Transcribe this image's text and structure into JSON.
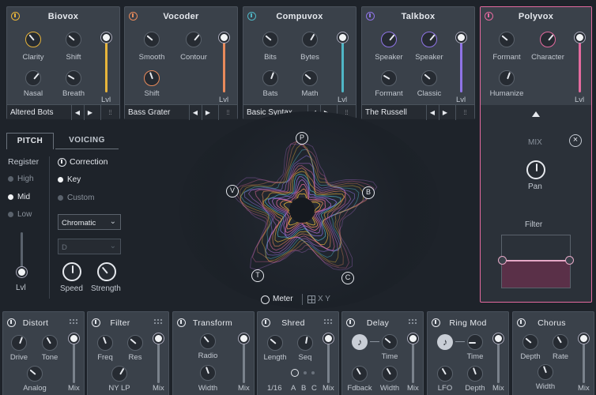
{
  "modules": [
    {
      "name": "Biovox",
      "color": "#e7b43b",
      "knobs": [
        "Clarity",
        "Shift",
        "Nasal",
        "Breath"
      ],
      "fader_label": "Lvl",
      "preset": "Altered Bots"
    },
    {
      "name": "Vocoder",
      "color": "#e88a5b",
      "knobs": [
        "Smooth",
        "Contour",
        "Shift"
      ],
      "fader_label": "Lvl",
      "preset": "Bass Grater"
    },
    {
      "name": "Compuvox",
      "color": "#4fb6c6",
      "knobs": [
        "Bits",
        "Bytes",
        "Bats",
        "Math"
      ],
      "fader_label": "Lvl",
      "preset": "Basic Syntax"
    },
    {
      "name": "Talkbox",
      "color": "#8f74e6",
      "knobs": [
        "Speaker",
        "Speaker",
        "Formant",
        "Classic"
      ],
      "fader_label": "Lvl",
      "preset": "The Russell"
    },
    {
      "name": "Polyvox",
      "color": "#e46a9f",
      "knobs": [
        "Formant",
        "Character",
        "Humanize"
      ],
      "fader_label": "Lvl"
    }
  ],
  "pitch": {
    "tabs": [
      "PITCH",
      "VOICING"
    ],
    "register_label": "Register",
    "registers": [
      "High",
      "Mid",
      "Low"
    ],
    "correction_label": "Correction",
    "corrections": [
      "Key",
      "Custom"
    ],
    "scale": "Chromatic",
    "key": "D",
    "lvl_label": "Lvl",
    "speed_label": "Speed",
    "strength_label": "Strength"
  },
  "visual": {
    "nodes": [
      "P",
      "B",
      "C",
      "T",
      "V"
    ],
    "meter_label": "Meter",
    "xy_label": "X Y"
  },
  "polyvox_panel": {
    "mix_label": "MIX",
    "pan_label": "Pan",
    "filter_label": "Filter"
  },
  "fx": [
    {
      "name": "Distort",
      "knobs": [
        "Drive",
        "Tone",
        "Analog"
      ],
      "fader_label": "Mix"
    },
    {
      "name": "Filter",
      "knobs": [
        "Freq",
        "Res",
        "NY LP"
      ],
      "fader_label": "Mix"
    },
    {
      "name": "Transform",
      "knobs": [
        "Radio",
        "Width"
      ],
      "fader_label": "Mix"
    },
    {
      "name": "Shred",
      "knobs": [
        "Length",
        "Seq"
      ],
      "extra": [
        "1/16",
        "A",
        "B",
        "C"
      ],
      "fader_label": "Mix"
    },
    {
      "name": "Delay",
      "knobs": [
        "Time",
        "Fdback",
        "Width"
      ],
      "fader_label": "Mix"
    },
    {
      "name": "Ring Mod",
      "knobs": [
        "Time",
        "LFO",
        "Depth"
      ],
      "fader_label": "Mix"
    },
    {
      "name": "Chorus",
      "knobs": [
        "Depth",
        "Rate",
        "Width"
      ],
      "fader_label": "Mix"
    }
  ],
  "icons": [
    "power-icon",
    "prev-icon",
    "next-icon",
    "sliders-icon",
    "close-icon",
    "note-icon",
    "chevron-down-icon",
    "meter-icon",
    "grid-icon",
    "triangle-up-icon"
  ],
  "colors": {
    "background": "#1e232a",
    "panel": "#3a414a",
    "accent_polyvox": "#e46a9f"
  }
}
